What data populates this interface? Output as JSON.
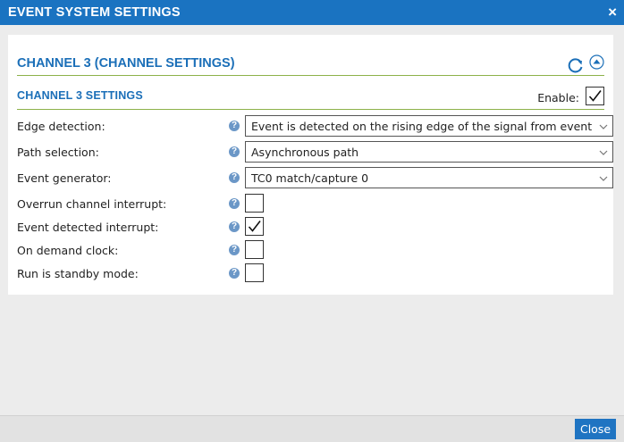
{
  "dialog": {
    "title": "EVENT SYSTEM SETTINGS",
    "close_glyph": "×",
    "close_button_label": "Close"
  },
  "section": {
    "title": "CHANNEL 3 (CHANNEL SETTINGS)",
    "icons": [
      "refresh-icon",
      "collapse-up-icon"
    ]
  },
  "subsection": {
    "title": "CHANNEL 3 SETTINGS",
    "enable_label": "Enable:",
    "enable_checked": true
  },
  "fields": {
    "edge_detection": {
      "label": "Edge detection:",
      "value": "Event is detected on the rising edge of the signal from event generator"
    },
    "path_selection": {
      "label": "Path selection:",
      "value": "Asynchronous path"
    },
    "event_generator": {
      "label": "Event generator:",
      "value": "TC0 match/capture 0"
    },
    "overrun_interrupt": {
      "label": "Overrun channel interrupt:",
      "checked": false
    },
    "event_detected_interrupt": {
      "label": "Event detected interrupt:",
      "checked": true
    },
    "on_demand_clock": {
      "label": "On demand clock:",
      "checked": false
    },
    "run_standby": {
      "label": "Run is standby mode:",
      "checked": false
    }
  },
  "help_glyph": "?",
  "colors": {
    "titlebar": "#1a73c1",
    "section_title": "#1b6fb8",
    "divider": "#8db24a",
    "help_icon": "#6b97c7",
    "close_button": "#1f74c2"
  }
}
